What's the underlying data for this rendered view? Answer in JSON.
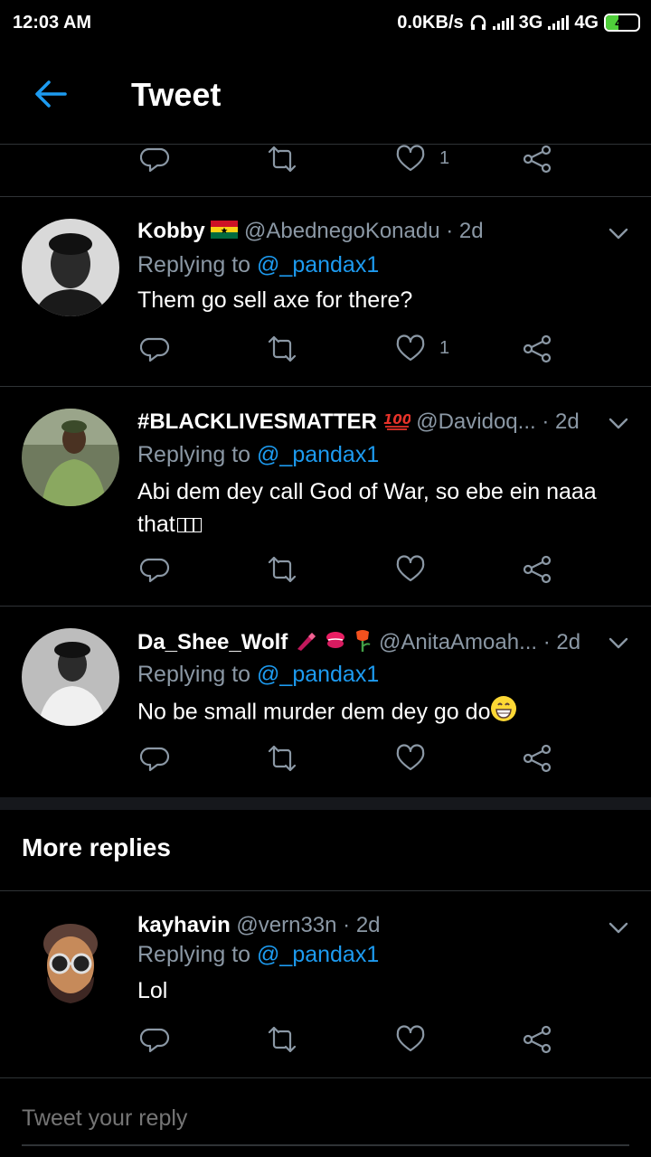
{
  "status_bar": {
    "time": "12:03 AM",
    "net_speed": "0.0KB/s",
    "net_3g": "3G",
    "net_4g": "4G",
    "battery": "40",
    "battery_level": 0.4
  },
  "header": {
    "title": "Tweet",
    "back_icon": "back-arrow-icon"
  },
  "top_actions": {
    "like_count": "1"
  },
  "tweets": [
    {
      "name": "Kobby",
      "handle": "@AbednegoKonadu",
      "time": "· 2d",
      "replying_label": "Replying to",
      "replying_to": "@_pandax1",
      "text": "Them go sell axe for there?",
      "like_count": "1"
    },
    {
      "name": "#BLACKLIVESMATTER",
      "handle": "@Davidoq...",
      "time": "· 2d",
      "replying_label": "Replying to",
      "replying_to": "@_pandax1",
      "text": "Abi dem dey call God of War, so ebe ein naaa that",
      "like_count": ""
    },
    {
      "name": "Da_Shee_Wolf",
      "handle": "@AnitaAmoah...",
      "time": "· 2d",
      "replying_label": "Replying to",
      "replying_to": "@_pandax1",
      "text": "No be small murder dem dey go do",
      "like_count": ""
    }
  ],
  "more_replies": {
    "heading": "More replies",
    "tweets": [
      {
        "name": "kayhavin",
        "handle": "@vern33n",
        "time": "· 2d",
        "replying_label": "Replying to",
        "replying_to": "@_pandax1",
        "text": "Lol",
        "like_count": ""
      }
    ]
  },
  "reply_box": {
    "placeholder": "Tweet your reply"
  },
  "colors": {
    "background": "#000000",
    "divider": "#2f3336",
    "secondary_text": "#8b98a5",
    "link": "#1d9bf0",
    "battery": "#4fcf3a"
  }
}
